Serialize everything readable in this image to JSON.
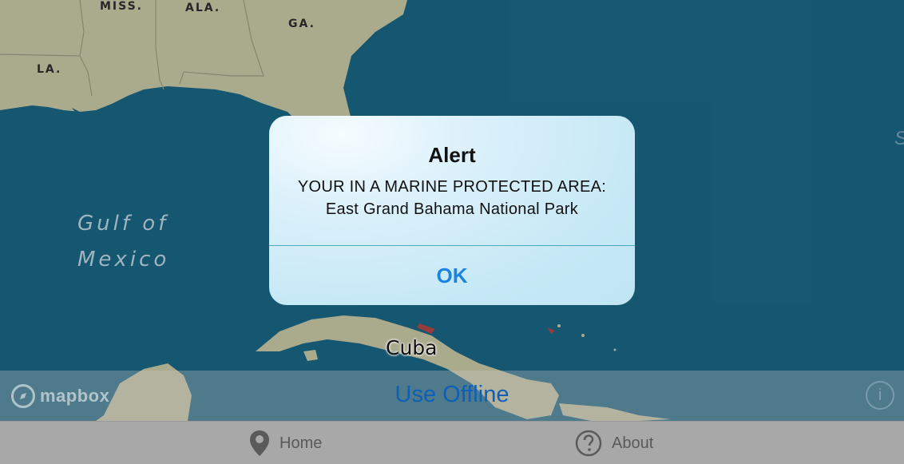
{
  "map": {
    "state_labels": [
      "MISS.",
      "ALA.",
      "GA.",
      "LA."
    ],
    "water_label": [
      "Gulf of",
      "Mexico"
    ],
    "country_label": "Cuba",
    "edge_label": "S",
    "colors": {
      "water": "#175c78",
      "land": "#b5b596",
      "border": "#8f8f78"
    }
  },
  "alert": {
    "title": "Alert",
    "message_line1": "YOUR IN A MARINE PROTECTED AREA:",
    "message_line2": "East Grand Bahama National Park",
    "ok_label": "OK",
    "accent": "#1a84e0"
  },
  "offline_bar": {
    "label": "Use Offline",
    "logo_text": "mapbox",
    "info_icon": "info-icon"
  },
  "tab_bar": {
    "home_label": "Home",
    "home_icon": "map-pin-icon",
    "about_label": "About",
    "about_icon": "question-circle-icon"
  }
}
